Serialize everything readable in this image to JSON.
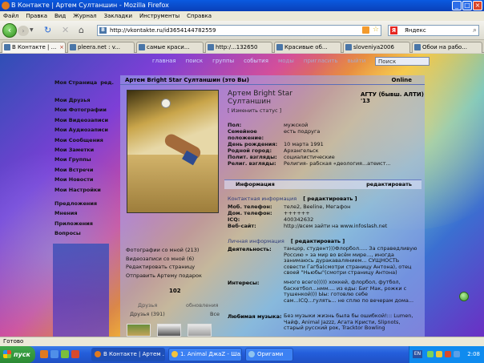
{
  "window": {
    "title": "В Контакте | Артем Султаншин - Mozilla Firefox"
  },
  "menubar": [
    "Файл",
    "Правка",
    "Вид",
    "Журнал",
    "Закладки",
    "Инструменты",
    "Справка"
  ],
  "navbar": {
    "url": "http://vkontakte.ru/id3654144782559",
    "search_engine": "Яндекс"
  },
  "tabs": [
    {
      "label": "В Контакте | ..."
    },
    {
      "label": "pleera.net : v..."
    },
    {
      "label": "самые краси..."
    },
    {
      "label": "http:/...132650"
    },
    {
      "label": "Красивые об..."
    },
    {
      "label": "sloveniya2006"
    },
    {
      "label": "Обои на рабо..."
    }
  ],
  "site_menu": [
    "главная",
    "поиск",
    "группы",
    "события",
    "моды",
    "пригласить",
    "выйти"
  ],
  "site_search": "Поиск",
  "left_menu": {
    "page": "Моя Страница",
    "edit": "ред.",
    "items": [
      "Мои Друзья",
      "Мои Фотографии",
      "Мои Видеозаписи",
      "Мои Аудиозаписи",
      "Мои Сообщения",
      "Мои Заметки",
      "Мои Группы",
      "Мои Встречи",
      "Мои Новости",
      "Мои Настройки"
    ],
    "items2": [
      "Предложения",
      "Мнения",
      "Приложения",
      "Вопросы"
    ]
  },
  "profile": {
    "header_name": "Артем Bright Star Султаншин (это Вы)",
    "online": "Online",
    "name_line1": "Артем Bright Star",
    "name_line2": "Султаншин",
    "change_status": "[ Изменить статус ]",
    "university": "АГТУ (бывш. АЛТИ) '13",
    "info": [
      {
        "k": "Пол:",
        "v": "мужской"
      },
      {
        "k": "Семейное положение:",
        "v": "есть подруга"
      },
      {
        "k": "День рождения:",
        "v": "10 марта 1991"
      },
      {
        "k": "Родной город:",
        "v": "Архангельск"
      },
      {
        "k": "Полит. взгляды:",
        "v": "социалистические"
      },
      {
        "k": "Религ. взгляды:",
        "v": "Религия- рабская «деология...атеист..."
      }
    ],
    "info_bar": {
      "left": "Информация",
      "right": "редактировать"
    },
    "contacts_title": "Контактная информация",
    "edit_link": "[ редактировать ]",
    "contacts": [
      {
        "k": "Моб. телефон:",
        "v": "теле2, Beeline, Мегафон"
      },
      {
        "k": "Дом. телефон:",
        "v": "++++++"
      },
      {
        "k": "ICQ:",
        "v": "400342632"
      },
      {
        "k": "Веб-сайт:",
        "v": "http://всем зайти на www.infoslash.net"
      }
    ],
    "personal_title": "Личная информация",
    "activity_label": "Деятельность:",
    "activity_text": "танцор, студент)))Флорбол..... За справедливую Россию » за мир во всём мире..., иногда занимаюсь дуракавалянием... СУЩНОСТЬ совести Гагба(смотри страницу Антона), отец своей \"Ньюбы\"(смотри страницу Антона)",
    "interests_label": "Интересы:",
    "interests_text": "много всего))))) хоккей, флорбол, футбол, баскетбол...нмм.... из еды: Биг Мак, рожки с тушенкой))) Ыы: готовлю себе сам...ICQ...гулять... не сплю по вечерам дома...",
    "music_label": "Любимая музыка:",
    "music_text": "Без музыки жизнь была бы ошибкой!::: Lumen, Чайф, Animal Jazzz, Агата Кристи, Slipnots, старый русский рок, Tracktor Bowling",
    "photos_with_me": "Фотографии со мной (213)",
    "videos_with_me": "Видеозаписи со мной (6)",
    "edit_page": "Редактировать страницу",
    "send_gift": "Отправить Артему подарок",
    "friends_number": "102",
    "friends_label": "Друзья",
    "friends_updates": "обновления",
    "friends_all": "Друзья (391)",
    "friends_all_link": "Все"
  },
  "statusbar": {
    "text": "Готово"
  },
  "taskbar": {
    "start": "пуск",
    "buttons": [
      "В Контакте | Артем ...",
      "1. Animal ДжаZ - Ша...",
      "Оригами"
    ],
    "lang": "EN",
    "clock": "2:08"
  },
  "colors": {
    "accent": "#0a5ae0",
    "vk": "#4a76a8"
  }
}
